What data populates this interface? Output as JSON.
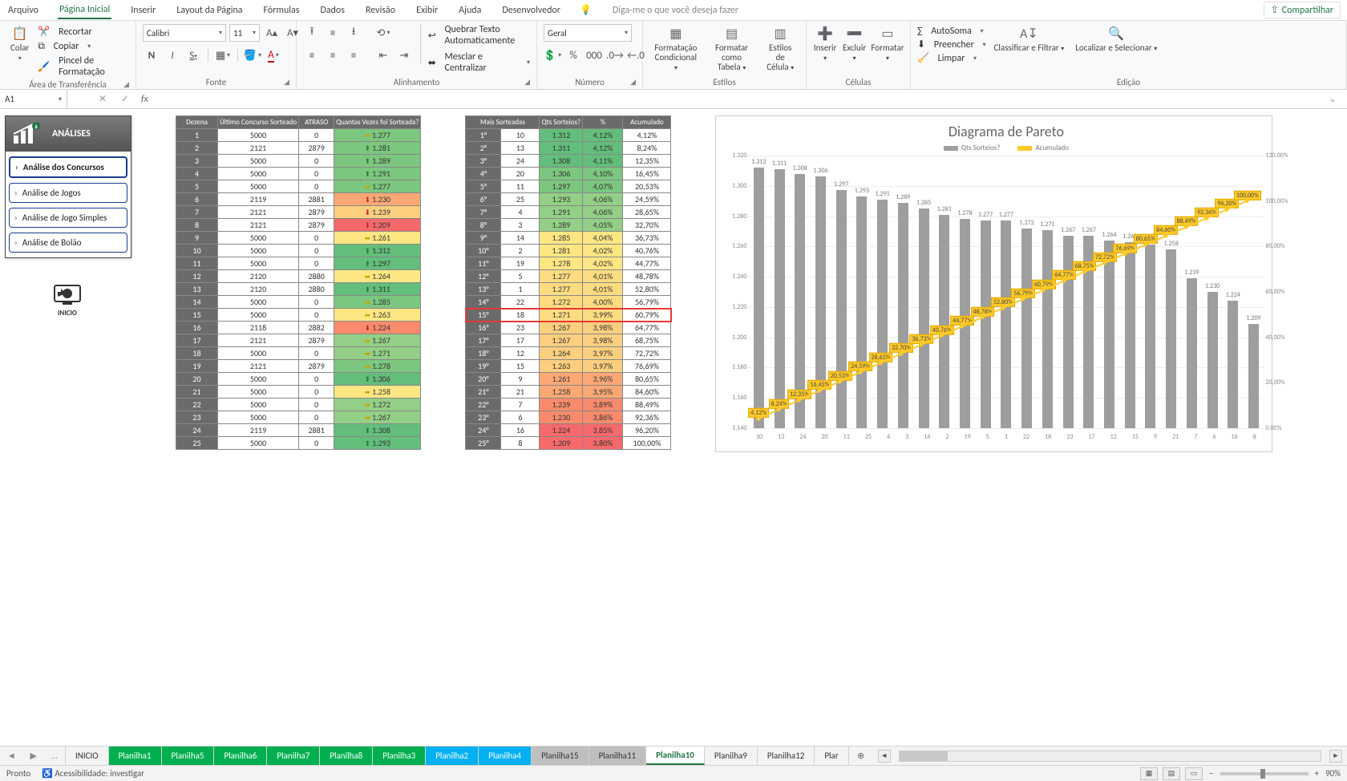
{
  "menu": {
    "tabs": [
      "Arquivo",
      "Página Inicial",
      "Inserir",
      "Layout da Página",
      "Fórmulas",
      "Dados",
      "Revisão",
      "Exibir",
      "Ajuda",
      "Desenvolvedor"
    ],
    "active": "Página Inicial",
    "tell_me": "Diga-me o que você deseja fazer",
    "share": "Compartilhar"
  },
  "ribbon": {
    "clipboard": {
      "paste": "Colar",
      "cut": "Recortar",
      "copy": "Copiar",
      "painter": "Pincel de Formatação",
      "label": "Área de Transferência"
    },
    "font": {
      "name": "Calibri",
      "size": "11",
      "bold": "N",
      "italic": "I",
      "underline": "S",
      "label": "Fonte"
    },
    "alignment": {
      "wrap": "Quebrar Texto Automaticamente",
      "merge": "Mesclar e Centralizar",
      "label": "Alinhamento"
    },
    "number": {
      "format": "Geral",
      "label": "Número"
    },
    "styles": {
      "condfmt": "Formatação Condicional",
      "astable": "Formatar como Tabela",
      "cellstyles": "Estilos de Célula",
      "label": "Estilos"
    },
    "cells": {
      "insert": "Inserir",
      "delete": "Excluir",
      "format": "Formatar",
      "label": "Células"
    },
    "editing": {
      "autosum": "AutoSoma",
      "fill": "Preencher",
      "clear": "Limpar",
      "sort": "Classificar e Filtrar",
      "find": "Localizar e Selecionar",
      "label": "Edição"
    }
  },
  "namebox": "A1",
  "analises": {
    "title": "ANÁLISES",
    "buttons": [
      "Análise dos Concursos",
      "Análise de Jogos",
      "Análise de Jogo Simples",
      "Análise de Bolão"
    ],
    "inicio": "INICIO"
  },
  "table1": {
    "headers": [
      "Dezena",
      "Último Concurso Sorteado",
      "ATRASO",
      "Quantas Vezes foi Sorteada?"
    ],
    "rows": [
      {
        "d": "1",
        "uc": "5000",
        "a": "0",
        "q": "1.277",
        "dir": "flat"
      },
      {
        "d": "2",
        "uc": "2121",
        "a": "2879",
        "q": "1.281",
        "dir": "up"
      },
      {
        "d": "3",
        "uc": "5000",
        "a": "0",
        "q": "1.289",
        "dir": "up"
      },
      {
        "d": "4",
        "uc": "5000",
        "a": "0",
        "q": "1.291",
        "dir": "up"
      },
      {
        "d": "5",
        "uc": "5000",
        "a": "0",
        "q": "1.277",
        "dir": "flat"
      },
      {
        "d": "6",
        "uc": "2119",
        "a": "2881",
        "q": "1.230",
        "dir": "down"
      },
      {
        "d": "7",
        "uc": "2121",
        "a": "2879",
        "q": "1.239",
        "dir": "down"
      },
      {
        "d": "8",
        "uc": "2121",
        "a": "2879",
        "q": "1.209",
        "dir": "down"
      },
      {
        "d": "9",
        "uc": "5000",
        "a": "0",
        "q": "1.261",
        "dir": "flat"
      },
      {
        "d": "10",
        "uc": "5000",
        "a": "0",
        "q": "1.312",
        "dir": "up"
      },
      {
        "d": "11",
        "uc": "5000",
        "a": "0",
        "q": "1.297",
        "dir": "up"
      },
      {
        "d": "12",
        "uc": "2120",
        "a": "2880",
        "q": "1.264",
        "dir": "flat"
      },
      {
        "d": "13",
        "uc": "2120",
        "a": "2880",
        "q": "1.311",
        "dir": "up"
      },
      {
        "d": "14",
        "uc": "5000",
        "a": "0",
        "q": "1.285",
        "dir": "flat"
      },
      {
        "d": "15",
        "uc": "5000",
        "a": "0",
        "q": "1.263",
        "dir": "flat"
      },
      {
        "d": "16",
        "uc": "2118",
        "a": "2882",
        "q": "1.224",
        "dir": "down"
      },
      {
        "d": "17",
        "uc": "2121",
        "a": "2879",
        "q": "1.267",
        "dir": "flat"
      },
      {
        "d": "18",
        "uc": "5000",
        "a": "0",
        "q": "1.271",
        "dir": "flat"
      },
      {
        "d": "19",
        "uc": "2121",
        "a": "2879",
        "q": "1.278",
        "dir": "flat"
      },
      {
        "d": "20",
        "uc": "5000",
        "a": "0",
        "q": "1.306",
        "dir": "up"
      },
      {
        "d": "21",
        "uc": "5000",
        "a": "0",
        "q": "1.258",
        "dir": "flat"
      },
      {
        "d": "22",
        "uc": "5000",
        "a": "0",
        "q": "1.272",
        "dir": "flat"
      },
      {
        "d": "23",
        "uc": "5000",
        "a": "0",
        "q": "1.267",
        "dir": "flat"
      },
      {
        "d": "24",
        "uc": "2119",
        "a": "2881",
        "q": "1.308",
        "dir": "up"
      },
      {
        "d": "25",
        "uc": "5000",
        "a": "0",
        "q": "1.293",
        "dir": "up"
      }
    ]
  },
  "table2": {
    "headers": [
      "Mais Sorteadas",
      "Qts Sorteios?",
      "%",
      "Acumulado"
    ],
    "rows": [
      {
        "r": "1°",
        "d": "10",
        "q": "1.312",
        "p": "4,12%",
        "a": "4,12%",
        "c": "bg-green"
      },
      {
        "r": "2°",
        "d": "13",
        "q": "1.311",
        "p": "4,12%",
        "a": "8,24%",
        "c": "bg-green"
      },
      {
        "r": "3°",
        "d": "24",
        "q": "1.308",
        "p": "4,11%",
        "a": "12,35%",
        "c": "bg-green"
      },
      {
        "r": "4°",
        "d": "20",
        "q": "1.306",
        "p": "4,10%",
        "a": "16,45%",
        "c": "bg-green2"
      },
      {
        "r": "5°",
        "d": "11",
        "q": "1.297",
        "p": "4,07%",
        "a": "20,53%",
        "c": "bg-green2"
      },
      {
        "r": "6°",
        "d": "25",
        "q": "1.293",
        "p": "4,06%",
        "a": "24,59%",
        "c": "bg-green3"
      },
      {
        "r": "7°",
        "d": "4",
        "q": "1.291",
        "p": "4,06%",
        "a": "28,65%",
        "c": "bg-green3"
      },
      {
        "r": "8°",
        "d": "3",
        "q": "1.289",
        "p": "4,05%",
        "a": "32,70%",
        "c": "bg-green3"
      },
      {
        "r": "9°",
        "d": "14",
        "q": "1.285",
        "p": "4,04%",
        "a": "36,73%",
        "c": "bg-yel1"
      },
      {
        "r": "10°",
        "d": "2",
        "q": "1.281",
        "p": "4,02%",
        "a": "40,76%",
        "c": "bg-yel1"
      },
      {
        "r": "11°",
        "d": "19",
        "q": "1.278",
        "p": "4,02%",
        "a": "44,77%",
        "c": "bg-yel1"
      },
      {
        "r": "12°",
        "d": "5",
        "q": "1.277",
        "p": "4,01%",
        "a": "48,78%",
        "c": "bg-yel2"
      },
      {
        "r": "13°",
        "d": "1",
        "q": "1.277",
        "p": "4,01%",
        "a": "52,80%",
        "c": "bg-yel2"
      },
      {
        "r": "14°",
        "d": "22",
        "q": "1.272",
        "p": "4,00%",
        "a": "56,79%",
        "c": "bg-yel2"
      },
      {
        "r": "15°",
        "d": "18",
        "q": "1.271",
        "p": "3,99%",
        "a": "60,79%",
        "c": "bg-yel2",
        "hl": true
      },
      {
        "r": "16°",
        "d": "23",
        "q": "1.267",
        "p": "3,98%",
        "a": "64,77%",
        "c": "bg-yel3"
      },
      {
        "r": "17°",
        "d": "17",
        "q": "1.267",
        "p": "3,98%",
        "a": "68,75%",
        "c": "bg-yel3"
      },
      {
        "r": "18°",
        "d": "12",
        "q": "1.264",
        "p": "3,97%",
        "a": "72,72%",
        "c": "bg-yel3"
      },
      {
        "r": "19°",
        "d": "15",
        "q": "1.263",
        "p": "3,97%",
        "a": "76,69%",
        "c": "bg-yel3"
      },
      {
        "r": "20°",
        "d": "9",
        "q": "1.261",
        "p": "3,96%",
        "a": "80,65%",
        "c": "bg-or1"
      },
      {
        "r": "21°",
        "d": "21",
        "q": "1.258",
        "p": "3,95%",
        "a": "84,60%",
        "c": "bg-or1"
      },
      {
        "r": "22°",
        "d": "7",
        "q": "1.239",
        "p": "3,89%",
        "a": "88,49%",
        "c": "bg-or2"
      },
      {
        "r": "23°",
        "d": "6",
        "q": "1.230",
        "p": "3,86%",
        "a": "92,36%",
        "c": "bg-or2"
      },
      {
        "r": "24°",
        "d": "16",
        "q": "1.224",
        "p": "3,85%",
        "a": "96,20%",
        "c": "bg-red"
      },
      {
        "r": "25°",
        "d": "8",
        "q": "1.209",
        "p": "3,80%",
        "a": "100,00%",
        "c": "bg-red"
      }
    ]
  },
  "chart_data": {
    "type": "bar",
    "title": "Diagrama de Pareto",
    "legend": [
      "Qts Sorteios?",
      "Acumulado"
    ],
    "categories": [
      "10",
      "13",
      "24",
      "20",
      "11",
      "25",
      "4",
      "3",
      "14",
      "2",
      "19",
      "5",
      "1",
      "22",
      "18",
      "23",
      "17",
      "12",
      "15",
      "9",
      "21",
      "7",
      "6",
      "16",
      "8"
    ],
    "series": [
      {
        "name": "Qts Sorteios?",
        "values": [
          1312,
          1311,
          1308,
          1306,
          1297,
          1293,
          1291,
          1289,
          1285,
          1281,
          1278,
          1277,
          1277,
          1272,
          1271,
          1267,
          1267,
          1264,
          1263,
          1261,
          1258,
          1239,
          1230,
          1224,
          1209
        ],
        "labels": [
          "1.312",
          "1.311",
          "1.308",
          "1.306",
          "1.297",
          "1.293",
          "1.291",
          "1.289",
          "1.285",
          "1.281",
          "1.278",
          "1.277",
          "1.277",
          "1.272",
          "1.271",
          "1.267",
          "1.267",
          "1.264",
          "1.263",
          "1.261",
          "1.258",
          "1.239",
          "1.230",
          "1.224",
          "1.209"
        ]
      },
      {
        "name": "Acumulado",
        "values": [
          4.12,
          8.24,
          12.35,
          16.45,
          20.53,
          24.59,
          28.65,
          32.7,
          36.73,
          40.76,
          44.77,
          48.78,
          52.8,
          56.79,
          60.79,
          64.77,
          68.75,
          72.72,
          76.69,
          80.65,
          84.6,
          88.49,
          92.36,
          96.2,
          100.0
        ],
        "labels": [
          "4,12%",
          "8,24%",
          "12,35%",
          "16,45%",
          "20,53%",
          "24,59%",
          "28,65%",
          "32,70%",
          "36,73%",
          "40,76%",
          "44,77%",
          "48,78%",
          "52,80%",
          "56,79%",
          "60,79%",
          "64,77%",
          "68,75%",
          "72,72%",
          "76,69%",
          "80,65%",
          "84,60%",
          "88,49%",
          "92,36%",
          "96,20%",
          "100,00%"
        ]
      }
    ],
    "ylim_left": [
      1140,
      1320
    ],
    "yticks_left": [
      "1.140",
      "1.160",
      "1.180",
      "1.200",
      "1.220",
      "1.240",
      "1.260",
      "1.280",
      "1.300",
      "1.320"
    ],
    "ylim_right": [
      0,
      120
    ],
    "yticks_right": [
      "0,00%",
      "20,00%",
      "40,00%",
      "60,00%",
      "80,00%",
      "100,00%",
      "120,00%"
    ]
  },
  "sheets": {
    "tabs": [
      {
        "label": "INICIO",
        "cls": ""
      },
      {
        "label": "Planilha1",
        "cls": "green"
      },
      {
        "label": "Planilha5",
        "cls": "green"
      },
      {
        "label": "Planilha6",
        "cls": "green"
      },
      {
        "label": "Planilha7",
        "cls": "green"
      },
      {
        "label": "Planilha8",
        "cls": "green"
      },
      {
        "label": "Planilha3",
        "cls": "green"
      },
      {
        "label": "Planilha2",
        "cls": "blue"
      },
      {
        "label": "Planilha4",
        "cls": "blue"
      },
      {
        "label": "Planilha15",
        "cls": "gray"
      },
      {
        "label": "Planilha11",
        "cls": "gray"
      },
      {
        "label": "Planilha10",
        "cls": "active"
      },
      {
        "label": "Planilha9",
        "cls": ""
      },
      {
        "label": "Planilha12",
        "cls": ""
      },
      {
        "label": "Plar",
        "cls": ""
      }
    ],
    "more": "..."
  },
  "status": {
    "ready": "Pronto",
    "access": "Acessibilidade: investigar",
    "zoom": "90%"
  }
}
